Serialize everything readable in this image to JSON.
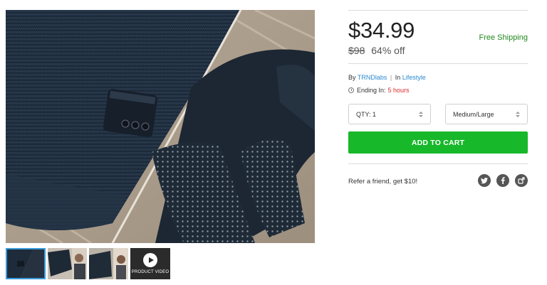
{
  "product": {
    "price": "$34.99",
    "old_price": "$98",
    "discount": "64% off",
    "shipping": "Free Shipping",
    "by_label": "By",
    "brand": "TRNDlabs",
    "in_label": "In",
    "category": "Lifestyle",
    "ending_label": "Ending In:",
    "ending_value": "5 hours"
  },
  "options": {
    "qty": "QTY: 1",
    "size": "Medium/Large"
  },
  "actions": {
    "add_to_cart": "ADD TO CART",
    "refer": "Refer a friend, get $10!"
  },
  "gallery": {
    "video_label": "PRODUCT VIDEO"
  },
  "share_icons": [
    "twitter-icon",
    "facebook-icon",
    "share-icon"
  ],
  "colors": {
    "accent_green": "#17b82a",
    "shipping_green": "#22891f",
    "link_blue": "#2a8ad0",
    "urgent_red": "#d92c2c"
  }
}
